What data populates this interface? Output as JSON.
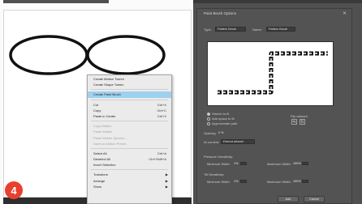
{
  "badge": {
    "number": "4",
    "color": "#e8402f"
  },
  "context_menu": {
    "group1": [
      {
        "label": "Create Motion Tween",
        "shortcut": ""
      },
      {
        "label": "Create Shape Tween",
        "shortcut": ""
      }
    ],
    "group2": [
      {
        "label": "Create Paint Brush",
        "shortcut": "",
        "selected": true
      }
    ],
    "group3": [
      {
        "label": "Cut",
        "shortcut": "Ctrl+X"
      },
      {
        "label": "Copy",
        "shortcut": "Ctrl+C"
      },
      {
        "label": "Paste in Center",
        "shortcut": "Ctrl+V"
      }
    ],
    "group4": [
      {
        "label": "Copy Motion",
        "disabled": true
      },
      {
        "label": "Paste Motion",
        "disabled": true
      },
      {
        "label": "Paste Motion Special...",
        "disabled": true
      },
      {
        "label": "Save as Motion Preset...",
        "disabled": true
      }
    ],
    "group5": [
      {
        "label": "Select All",
        "shortcut": "Ctrl+A"
      },
      {
        "label": "Deselect All",
        "shortcut": "Ctrl+Shift+A"
      },
      {
        "label": "Invert Selection",
        "shortcut": ""
      }
    ],
    "group6": [
      {
        "label": "Transform",
        "submenu": true
      },
      {
        "label": "Arrange",
        "submenu": true
      },
      {
        "label": "Show",
        "submenu": true
      }
    ]
  },
  "dialog": {
    "title": "Paint Brush Options",
    "close_glyph": "×",
    "type_label": "Type:",
    "type_value": "Pattern Brush",
    "name_label": "Name:",
    "name_value": "Pattern Brush",
    "options": [
      {
        "label": "Stretch to fit",
        "checked": true
      },
      {
        "label": "Add space to fit",
        "checked": false
      },
      {
        "label": "Approximate path",
        "checked": false
      }
    ],
    "flip_label": "Flip artwork:",
    "spacing_label": "Spacing:",
    "spacing_value": "0 %",
    "at_corners_label": "At corners:",
    "at_corners_value": "Extend artwork",
    "pressure_label": "Pressure Sensitivity:",
    "pressure_min_label": "Minimum Width:",
    "pressure_min_value": "1%",
    "pressure_max_label": "Maximum Width:",
    "pressure_max_value": "100%",
    "tilt_label": "Tilt Sensitivity:",
    "tilt_min_label": "Minimum Width:",
    "tilt_min_value": "1%",
    "tilt_max_label": "Maximum Width:",
    "tilt_max_value": "100%",
    "add_button": "Add",
    "cancel_button": "Cancel"
  }
}
